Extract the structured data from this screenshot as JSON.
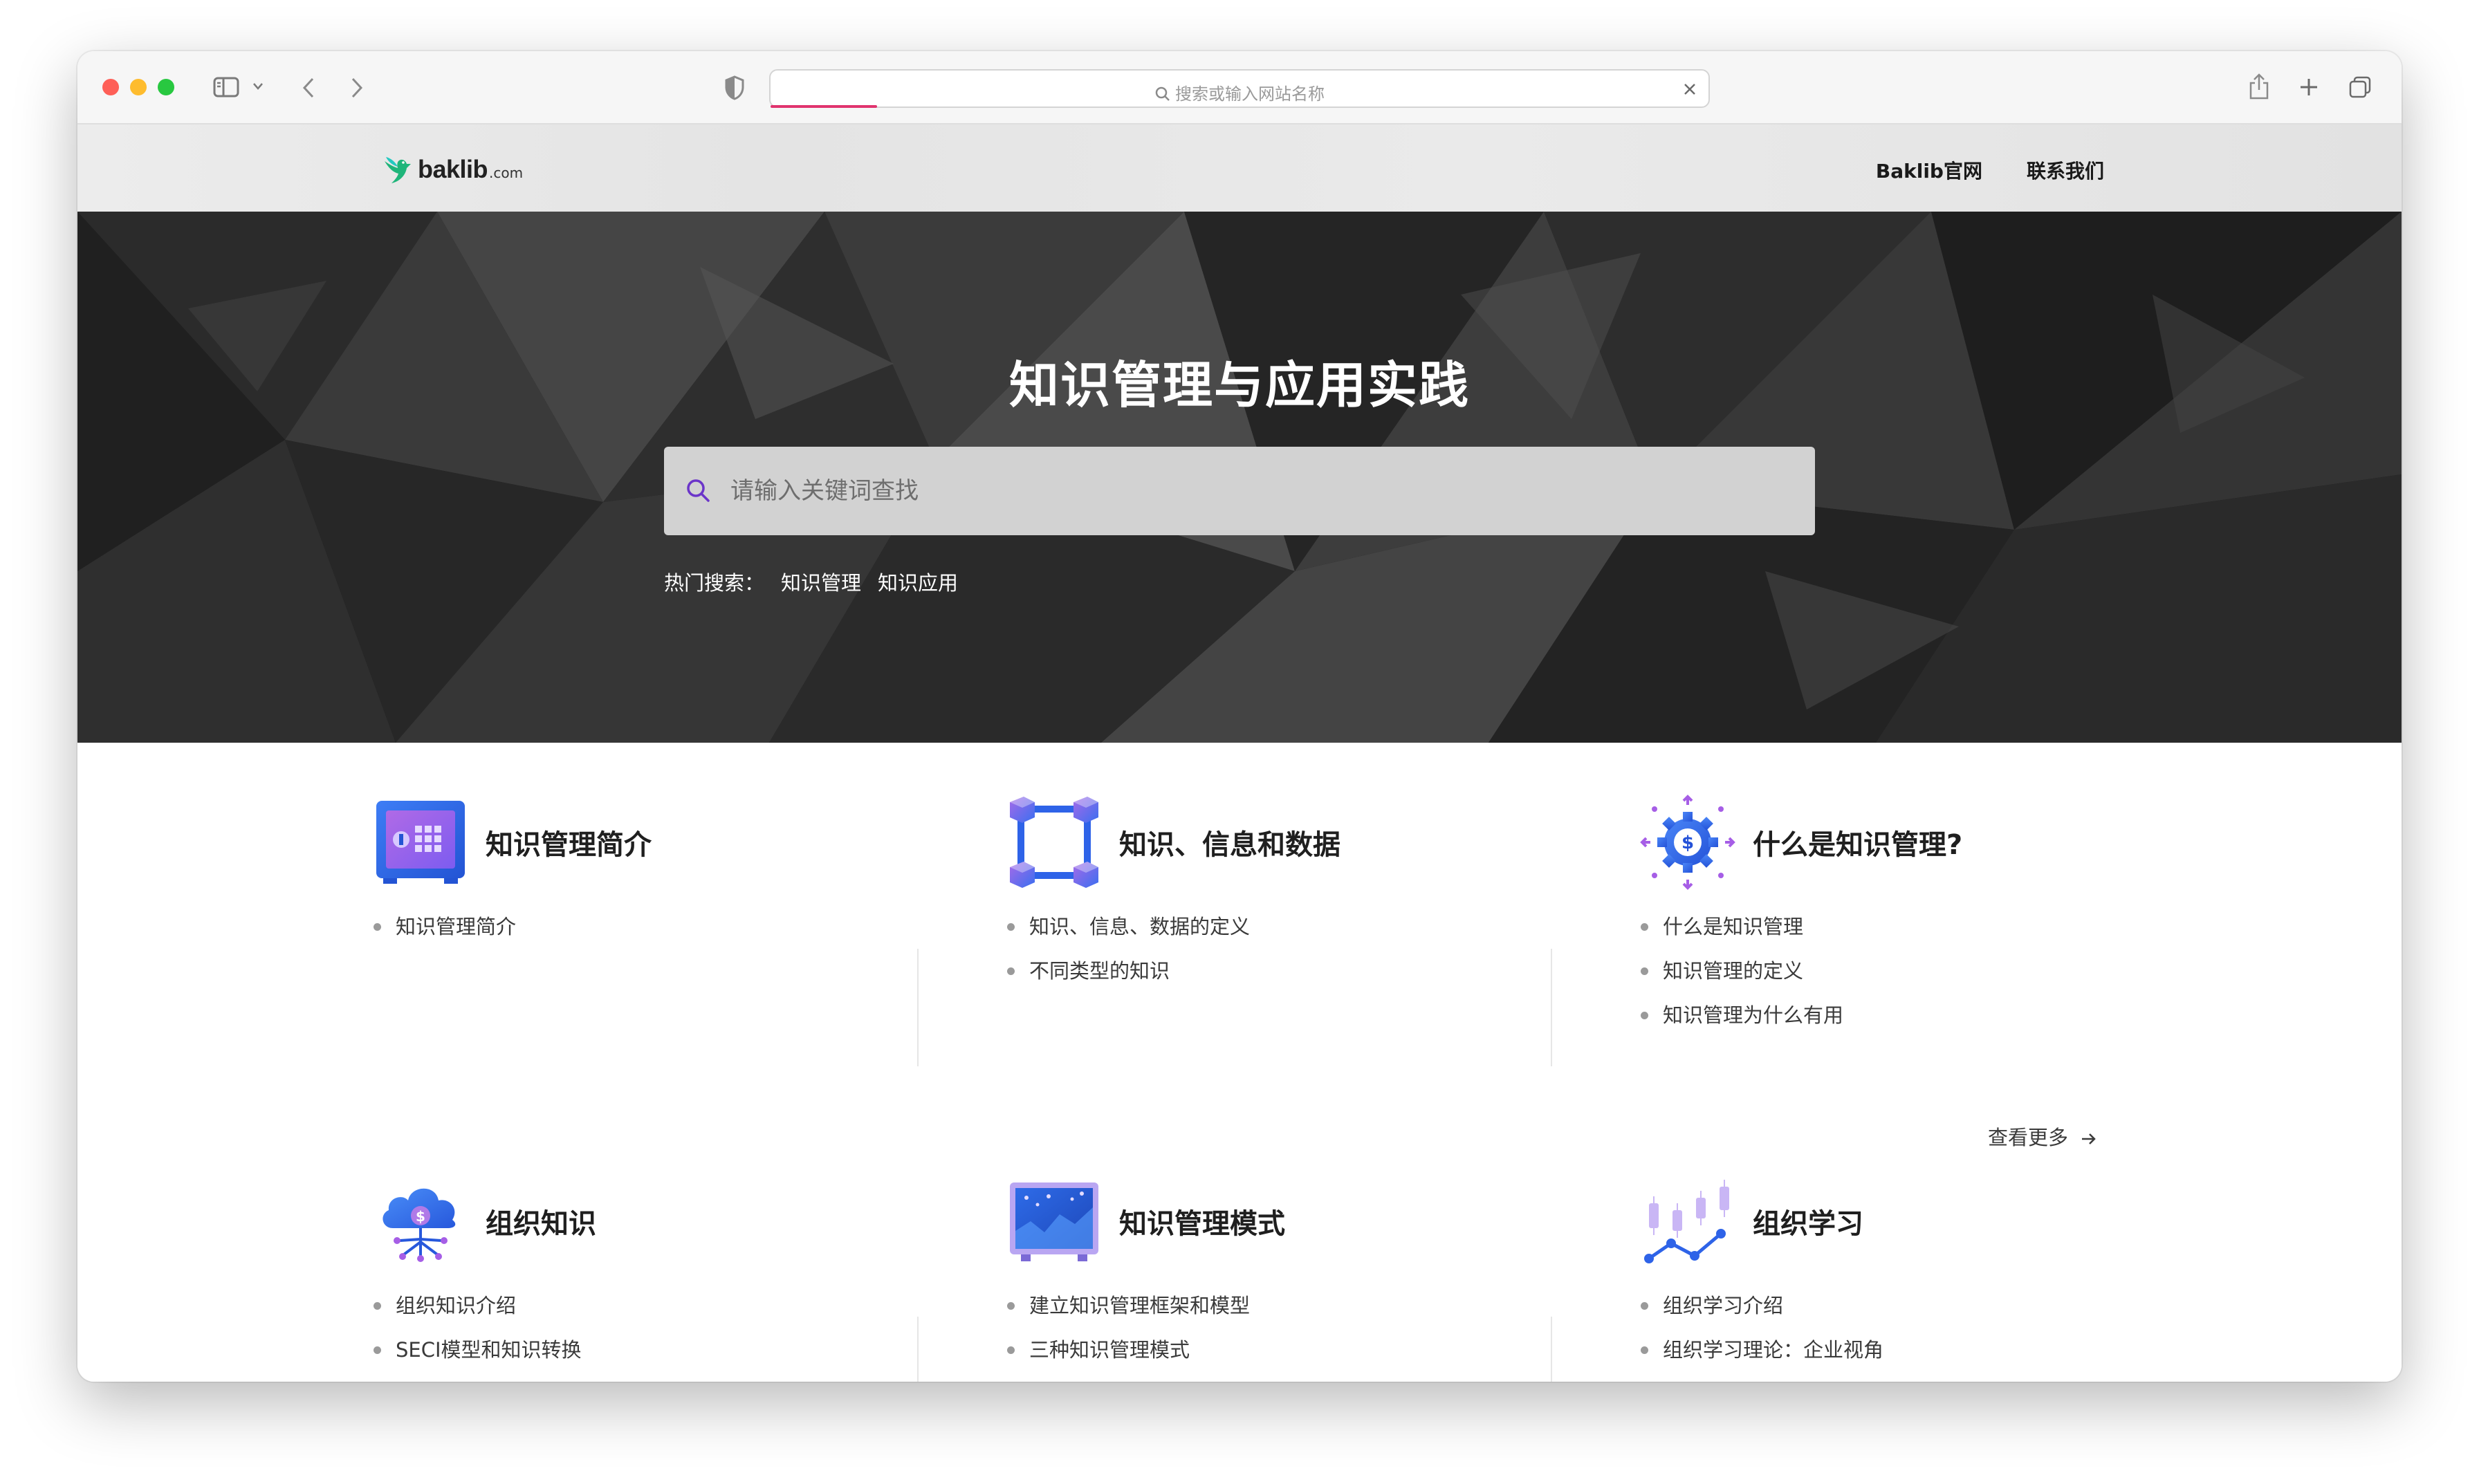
{
  "browser": {
    "address_placeholder": "搜索或输入网站名称"
  },
  "site": {
    "logo_text": "baklib",
    "logo_suffix": ".com",
    "nav": [
      "Baklib官网",
      "联系我们"
    ]
  },
  "hero": {
    "title": "知识管理与应用实践",
    "search_placeholder": "请输入关键词查找",
    "hot_label": "热门搜索：",
    "hot_terms": [
      "知识管理",
      "知识应用"
    ]
  },
  "cards": [
    {
      "title": "知识管理简介",
      "icon": "safe-icon",
      "items": [
        "知识管理简介"
      ]
    },
    {
      "title": "知识、信息和数据",
      "icon": "cube-network-icon",
      "items": [
        "知识、信息、数据的定义",
        "不同类型的知识"
      ]
    },
    {
      "title": "什么是知识管理?",
      "icon": "money-gear-icon",
      "items": [
        "什么是知识管理",
        "知识管理的定义",
        "知识管理为什么有用"
      ],
      "more": "查看更多"
    },
    {
      "title": "组织知识",
      "icon": "cloud-money-icon",
      "items": [
        "组织知识介绍",
        "SECI模型和知识转换"
      ]
    },
    {
      "title": "知识管理模式",
      "icon": "dashboard-screen-icon",
      "items": [
        "建立知识管理框架和模型",
        "三种知识管理模式"
      ]
    },
    {
      "title": "组织学习",
      "icon": "candlestick-chart-icon",
      "items": [
        "组织学习介绍",
        "组织学习理论：企业视角"
      ]
    }
  ]
}
